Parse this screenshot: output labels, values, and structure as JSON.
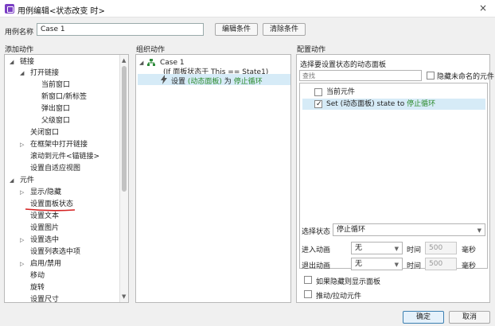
{
  "window": {
    "title": "用例编辑<状态改变 时>",
    "close": "×"
  },
  "case_row": {
    "label": "用例名称",
    "value": "Case 1",
    "edit_condition": "编辑条件",
    "clear_condition": "清除条件"
  },
  "headers": {
    "add_action": "添加动作",
    "organize_action": "组织动作",
    "configure_action": "配置动作"
  },
  "left_tree": [
    {
      "label": "链接",
      "arrow": "◢"
    },
    {
      "label": "打开链接",
      "arrow": "◢"
    },
    {
      "label": "当前窗口"
    },
    {
      "label": "新窗口/新标签"
    },
    {
      "label": "弹出窗口"
    },
    {
      "label": "父级窗口"
    },
    {
      "label": "关闭窗口"
    },
    {
      "label": "在框架中打开链接",
      "arrow": "▷"
    },
    {
      "label": "滚动到元件<锚链接>"
    },
    {
      "label": "设置自适应视图"
    },
    {
      "label": "元件",
      "arrow": "◢"
    },
    {
      "label": "显示/隐藏",
      "arrow": "▷"
    },
    {
      "label": "设置面板状态"
    },
    {
      "label": "设置文本"
    },
    {
      "label": "设置图片"
    },
    {
      "label": "设置选中",
      "arrow": "▷"
    },
    {
      "label": "设置列表选中项"
    },
    {
      "label": "启用/禁用",
      "arrow": "▷"
    },
    {
      "label": "移动"
    },
    {
      "label": "旋转"
    },
    {
      "label": "设置尺寸"
    }
  ],
  "middle": {
    "case_name": "Case 1",
    "condition": "(If 面板状态于 This == State1)",
    "action_prefix": "设置",
    "action_target": "(动态面板)",
    "action_word": "为",
    "action_state": "停止循环"
  },
  "right": {
    "panel_label": "选择要设置状态的动态面板",
    "search_placeholder": "查找",
    "hide_unnamed": "隐藏未命名的元件",
    "list": [
      {
        "label_prefix": "当前元件",
        "label_state": "",
        "checked": false
      },
      {
        "label_prefix": "Set (动态面板) state to",
        "label_state": "停止循环",
        "checked": true
      }
    ],
    "select_state_label": "选择状态",
    "select_state_value": "停止循环",
    "enter_anim_label": "进入动画",
    "enter_anim_value": "无",
    "exit_anim_label": "退出动画",
    "exit_anim_value": "无",
    "time_label": "时间",
    "time_value": "500",
    "ms_label": "毫秒",
    "show_if_hidden": "如果隐藏则显示面板",
    "push_pull": "推动/拉动元件"
  },
  "buttons": {
    "ok": "确定",
    "cancel": "取消"
  },
  "colors": {
    "accent": "#7b3fc4",
    "selection": "#d6ebf7",
    "state_text": "#2a8a2a",
    "annotation": "#d42020"
  }
}
